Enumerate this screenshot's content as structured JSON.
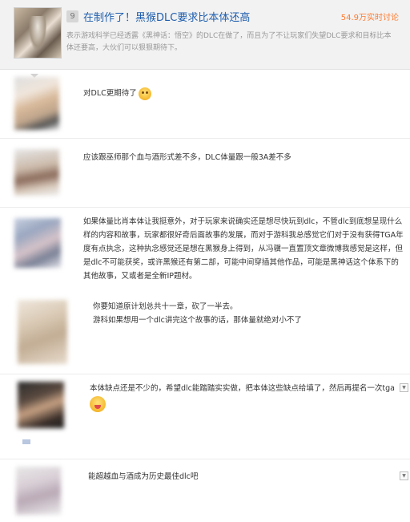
{
  "header": {
    "rank": "9",
    "title": "在制作了！黑猴DLC要求比本体还高",
    "hot": "54.9万实时讨论",
    "desc": "表示游戏科学已经透露《黑神话：悟空》的DLC在做了，而且为了不让玩家们失望DLC要求和目标比本体还要高，大伙们可以狠狠期待下。"
  },
  "comments": [
    {
      "text": "对DLC更期待了",
      "emoji": "smile-emoji"
    },
    {
      "text": "应该跟巫师那个血与酒形式差不多，DLC体量跟一般3A差不多"
    },
    {
      "text": "如果体量比肖本体让我挺意外，对于玩家来说确实还是想尽快玩到dlc，不管dlc到底想呈现什么样的内容和故事，玩家都很好奇后面故事的发展，而对于游科我总感觉它们对于没有获得TGA年度有点执念，这种执念感觉还是想在黑猴身上得到，从冯骥一直置顶文章微博我感觉是这样，但是dlc不可能获奖，或许黑猴还有第二部，可能中间穿插其他作品，可能是黑神话这个体系下的其他故事，又或者是全新IP题材。"
    },
    {
      "lines": [
        "你要知道原计划总共十一章，砍了一半去。",
        "游科如果想用一个dlc讲完这个故事的话，那体量就绝对小不了"
      ]
    },
    {
      "text": "本体缺点还是不少的，希望dlc能踏踏实实做，把本体这些缺点给填了，然后再提名一次tga",
      "emoji": "tongue-emoji"
    },
    {
      "text": "能超越血与酒成为历史最佳dlc吧"
    }
  ]
}
